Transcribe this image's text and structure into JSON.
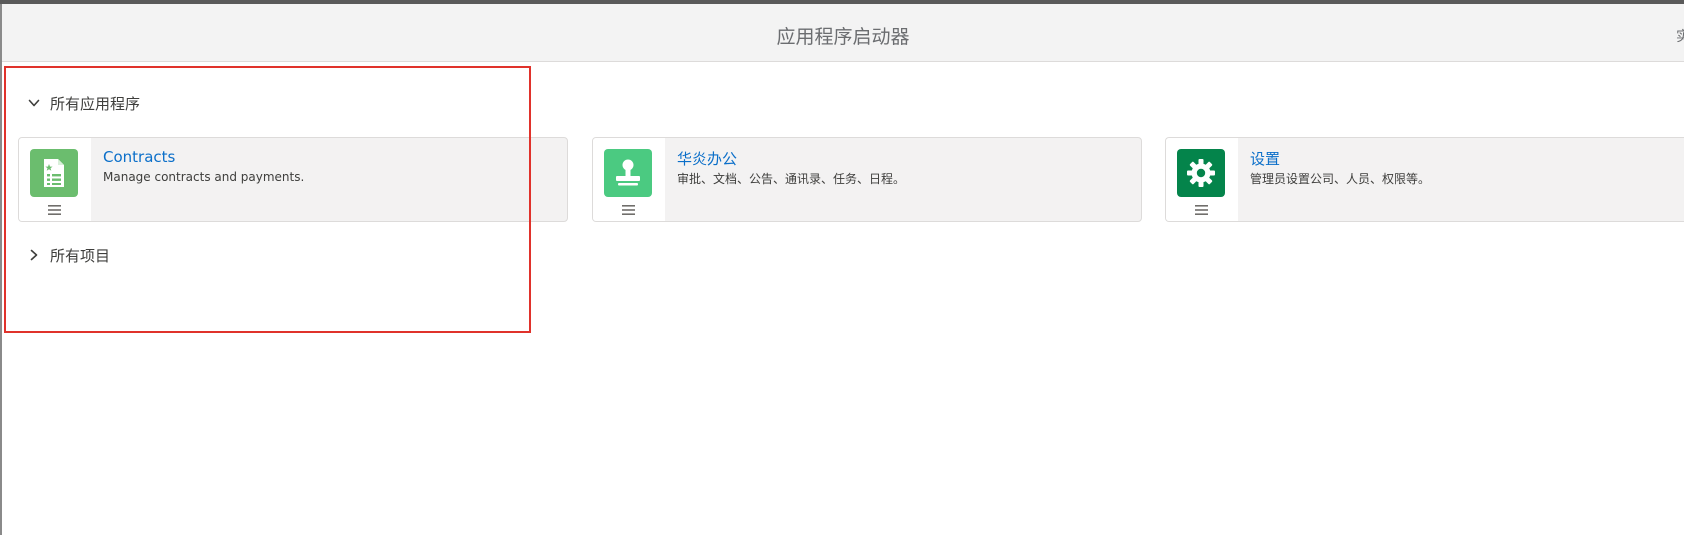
{
  "header": {
    "title": "应用程序启动器",
    "right_partial": "实"
  },
  "sections": {
    "all_apps": {
      "label": "所有应用程序",
      "expanded": true
    },
    "all_items": {
      "label": "所有项目",
      "expanded": false
    }
  },
  "apps": [
    {
      "title": "Contracts",
      "description": "Manage contracts and payments.",
      "icon": "contract-document-icon",
      "icon_color": "#6bbd6e"
    },
    {
      "title": "华炎办公",
      "description": "审批、文档、公告、通讯录、任务、日程。",
      "icon": "stamp-icon",
      "icon_color": "#4bca81"
    },
    {
      "title": "设置",
      "description": "管理员设置公司、人员、权限等。",
      "icon": "gear-icon",
      "icon_color": "#04844b"
    }
  ],
  "colors": {
    "accent_link": "#0b6fc9",
    "highlight_border": "#e0322b"
  }
}
